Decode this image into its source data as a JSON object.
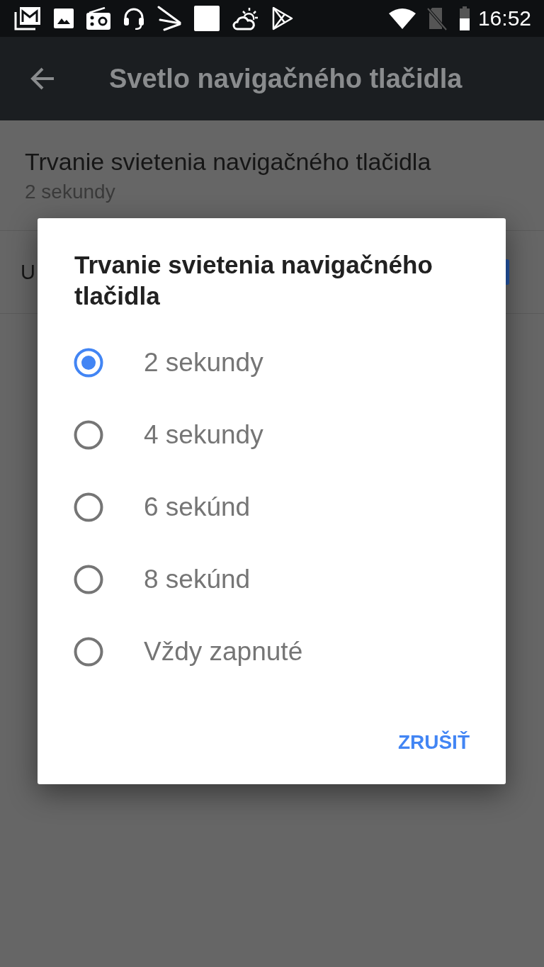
{
  "status_bar": {
    "time": "16:52"
  },
  "app_bar": {
    "title": "Svetlo navigačného tlačidla"
  },
  "settings": [
    {
      "kind": "text",
      "title": "Trvanie svietenia navigačného tlačidla",
      "summary": "2 sekundy"
    },
    {
      "kind": "checkbox",
      "title": "U",
      "checked": true
    }
  ],
  "dialog": {
    "title": "Trvanie svietenia navigačného tlačidla",
    "options": [
      {
        "label": "2 sekundy",
        "selected": true
      },
      {
        "label": "4 sekundy",
        "selected": false
      },
      {
        "label": "6 sekúnd",
        "selected": false
      },
      {
        "label": "8 sekúnd",
        "selected": false
      },
      {
        "label": "Vždy zapnuté",
        "selected": false
      }
    ],
    "buttons": [
      "ZRUŠIŤ"
    ]
  }
}
